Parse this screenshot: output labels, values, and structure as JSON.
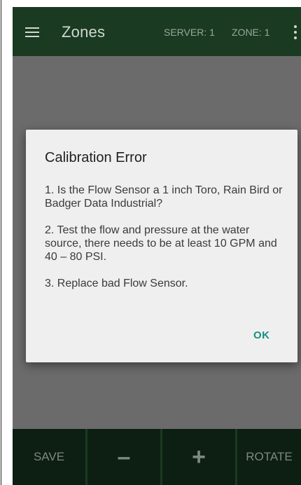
{
  "app_bar": {
    "title": "Zones",
    "server_label": "SERVER: 1",
    "zone_label": "ZONE: 1",
    "menu_icon": "hamburger-menu-icon",
    "overflow_icon": "more-vert-icon"
  },
  "dialog": {
    "title": "Calibration Error",
    "paragraphs": [
      "1. Is the Flow Sensor a 1 inch Toro, Rain Bird or Badger Data Industrial?",
      "2. Test the flow and pressure at the water source, there needs to be at least 10 GPM and 40 – 80 PSI.",
      "3. Replace bad Flow Sensor."
    ],
    "ok_label": "OK"
  },
  "bottom_bar": {
    "save_label": "SAVE",
    "minus_label": "–",
    "plus_label": "+",
    "rotate_label": "ROTATE"
  },
  "colors": {
    "app_bar": "#1a3a22",
    "bottom_button": "#0d1e12",
    "scrim": "#6b6b6b",
    "dialog_bg": "#efefef",
    "accent": "#16907f"
  }
}
